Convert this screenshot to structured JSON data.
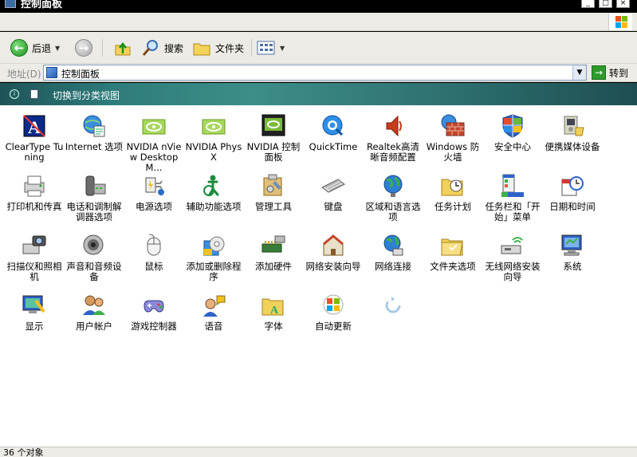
{
  "window": {
    "title": "控制面板"
  },
  "toolbar": {
    "back_label": "后退",
    "search_label": "搜索",
    "folders_label": "文件夹"
  },
  "address": {
    "label": "地址(D)",
    "value": "控制面板",
    "go_label": "转到"
  },
  "taskstrip": {
    "switch_label": "切换到分类视图"
  },
  "items": [
    {
      "label": "ClearType Tuning",
      "icon": "cleartype-icon"
    },
    {
      "label": "Internet 选项",
      "icon": "internet-options-icon"
    },
    {
      "label": "NVIDIA nView Desktop M...",
      "icon": "nvidia-nview-icon"
    },
    {
      "label": "NVIDIA PhysX",
      "icon": "nvidia-physx-icon"
    },
    {
      "label": "NVIDIA 控制面板",
      "icon": "nvidia-control-panel-icon"
    },
    {
      "label": "QuickTime",
      "icon": "quicktime-icon"
    },
    {
      "label": "Realtek高清晰音频配置",
      "icon": "realtek-audio-icon"
    },
    {
      "label": "Windows 防火墙",
      "icon": "firewall-icon"
    },
    {
      "label": "安全中心",
      "icon": "security-center-icon"
    },
    {
      "label": "便携媒体设备",
      "icon": "portable-media-icon"
    },
    {
      "label": "打印机和传真",
      "icon": "printers-icon"
    },
    {
      "label": "电话和调制解调器选项",
      "icon": "phone-modem-icon"
    },
    {
      "label": "电源选项",
      "icon": "power-options-icon"
    },
    {
      "label": "辅助功能选项",
      "icon": "accessibility-icon"
    },
    {
      "label": "管理工具",
      "icon": "admin-tools-icon"
    },
    {
      "label": "键盘",
      "icon": "keyboard-icon"
    },
    {
      "label": "区域和语言选项",
      "icon": "region-language-icon"
    },
    {
      "label": "任务计划",
      "icon": "scheduled-tasks-icon"
    },
    {
      "label": "任务栏和「开始」菜单",
      "icon": "taskbar-start-icon"
    },
    {
      "label": "日期和时间",
      "icon": "date-time-icon"
    },
    {
      "label": "扫描仪和照相机",
      "icon": "scanner-camera-icon"
    },
    {
      "label": "声音和音频设备",
      "icon": "sound-icon"
    },
    {
      "label": "鼠标",
      "icon": "mouse-icon"
    },
    {
      "label": "添加或删除程序",
      "icon": "add-remove-programs-icon"
    },
    {
      "label": "添加硬件",
      "icon": "add-hardware-icon"
    },
    {
      "label": "网络安装向导",
      "icon": "network-setup-icon"
    },
    {
      "label": "网络连接",
      "icon": "network-connections-icon"
    },
    {
      "label": "文件夹选项",
      "icon": "folder-options-icon"
    },
    {
      "label": "无线网络安装向导",
      "icon": "wireless-setup-icon"
    },
    {
      "label": "系统",
      "icon": "system-icon"
    },
    {
      "label": "显示",
      "icon": "display-icon"
    },
    {
      "label": "用户帐户",
      "icon": "user-accounts-icon"
    },
    {
      "label": "游戏控制器",
      "icon": "game-controllers-icon"
    },
    {
      "label": "语音",
      "icon": "speech-icon"
    },
    {
      "label": "字体",
      "icon": "fonts-icon"
    },
    {
      "label": "自动更新",
      "icon": "automatic-updates-icon"
    },
    {
      "label": "",
      "icon": "loading-icon"
    }
  ],
  "status": {
    "text": "36 个对象"
  }
}
